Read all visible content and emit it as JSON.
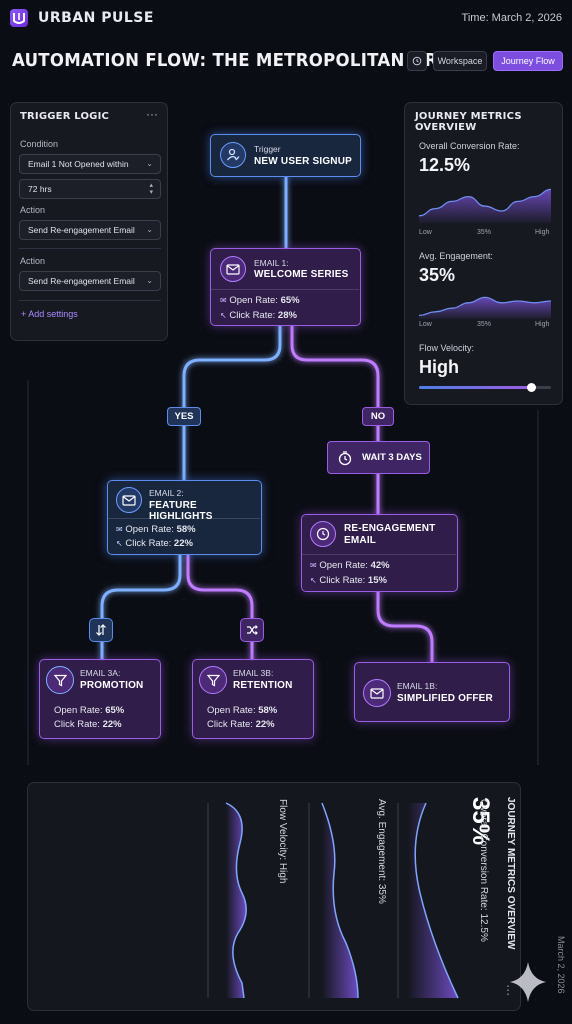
{
  "app": {
    "brand": "URBAN PULSE",
    "time": "Time: March 2, 2026"
  },
  "header": {
    "title": "AUTOMATION FLOW: THE METROPOLITAN GRID",
    "history_icon": "history-icon",
    "workspace_label": "Workspace",
    "journey_label": "Journey Flow"
  },
  "trigger_logic": {
    "title": "TRIGGER LOGIC",
    "menu": "···",
    "condition_label": "Condition",
    "condition_value": "Email 1 Not Opened within",
    "duration_value": "72 hrs",
    "action1_label": "Action",
    "action1_value": "Send Re-engagement Email",
    "action2_label": "Action",
    "action2_value": "Send Re-engagement Email",
    "add_settings": "+ Add settings"
  },
  "metrics": {
    "title": "JOURNEY METRICS OVERVIEW",
    "conversion_label": "Overall Conversion Rate:",
    "conversion_value": "12.5%",
    "engagement_label": "Avg. Engagement:",
    "engagement_value": "35%",
    "axis_low": "Low",
    "axis_mid": "35%",
    "axis_high": "High",
    "velocity_label": "Flow Velocity:",
    "velocity_value": "High",
    "velocity_level": 0.85,
    "conversion_series": [
      0.15,
      0.3,
      0.45,
      0.55,
      0.35,
      0.25,
      0.45,
      0.55,
      0.7
    ],
    "engagement_series": [
      0.1,
      0.2,
      0.3,
      0.45,
      0.6,
      0.45,
      0.5,
      0.45,
      0.5
    ]
  },
  "flow": {
    "trigger": {
      "header": "Trigger",
      "title": "NEW USER SIGNUP"
    },
    "email1": {
      "header": "EMAIL 1:",
      "title": "WELCOME SERIES",
      "open": "Open Rate: ",
      "open_val": "65%",
      "click": "Click Rate: ",
      "click_val": "28%"
    },
    "yes": "YES",
    "no": "NO",
    "wait": "WAIT 3 DAYS",
    "email2": {
      "header": "EMAIL 2:",
      "title": "FEATURE HIGHLIGHTS",
      "open": "Open Rate: ",
      "open_val": "58%",
      "click": "Click Rate: ",
      "click_val": "22%"
    },
    "reengage": {
      "title1": "RE-ENGAGEMENT",
      "title2": "EMAIL",
      "open": "Open Rate: ",
      "open_val": "42%",
      "click": "Click Rate: ",
      "click_val": "15%"
    },
    "email3a": {
      "header": "EMAIL 3A:",
      "title": "PROMOTION",
      "open": "Open Rate: ",
      "open_val": "65%",
      "click": "Click Rate: ",
      "click_val": "22%"
    },
    "email3b": {
      "header": "EMAIL 3B:",
      "title": "RETENTION",
      "open": "Open Rate: ",
      "open_val": "58%",
      "click": "Click Rate: ",
      "click_val": "22%"
    },
    "email1b": {
      "header": "EMAIL 1B:",
      "title": "SIMPLIFIED OFFER"
    }
  },
  "bottom": {
    "title": "JOURNEY METRICS OVERVIEW",
    "big_value": "35%",
    "conversion": "Overall Conversion Rate: 12.5%",
    "engagement": "Avg. Engagement: 35%",
    "velocity": "Flow Velocity: High",
    "more": "⋮",
    "date": "March 2, 2026"
  },
  "colors": {
    "accent": "#7c4ddf",
    "blue": "#5b8def",
    "purple": "#9b5de5",
    "bg": "#0b0d14"
  }
}
